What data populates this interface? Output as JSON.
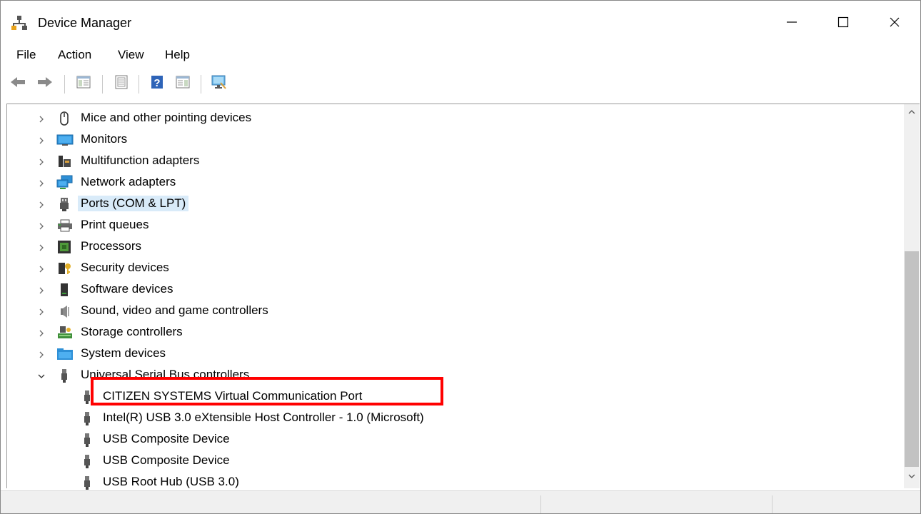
{
  "window": {
    "title": "Device Manager",
    "controls": [
      "minimize-icon",
      "maximize-icon",
      "close-icon"
    ]
  },
  "menu": [
    {
      "label": "File"
    },
    {
      "label": "Action"
    },
    {
      "label": "View"
    },
    {
      "label": "Help"
    }
  ],
  "toolbar": {
    "buttons": [
      "back-arrow-icon",
      "forward-arrow-icon",
      "show-hide-console-tree-icon",
      "properties-icon",
      "help-icon",
      "action-pane-icon",
      "scan-hardware-icon"
    ]
  },
  "tree": {
    "categories": [
      {
        "label": "Mice and other pointing devices",
        "icon": "mouse-icon"
      },
      {
        "label": "Monitors",
        "icon": "monitor-icon"
      },
      {
        "label": "Multifunction adapters",
        "icon": "multifunction-adapter-icon"
      },
      {
        "label": "Network adapters",
        "icon": "network-adapter-icon"
      },
      {
        "label": "Ports (COM & LPT)",
        "icon": "port-icon",
        "selected": true
      },
      {
        "label": "Print queues",
        "icon": "printer-icon"
      },
      {
        "label": "Processors",
        "icon": "processor-icon"
      },
      {
        "label": "Security devices",
        "icon": "security-key-icon"
      },
      {
        "label": "Software devices",
        "icon": "software-device-icon"
      },
      {
        "label": "Sound, video and game controllers",
        "icon": "speaker-icon"
      },
      {
        "label": "Storage controllers",
        "icon": "storage-controller-icon"
      },
      {
        "label": "System devices",
        "icon": "system-folder-icon"
      },
      {
        "label": "Universal Serial Bus controllers",
        "icon": "usb-icon",
        "expanded": true
      }
    ],
    "usb_children": [
      {
        "label": "CITIZEN SYSTEMS Virtual Communication Port",
        "icon": "usb-plug-icon",
        "highlighted": true
      },
      {
        "label": "Intel(R) USB 3.0 eXtensible Host Controller - 1.0 (Microsoft)",
        "icon": "usb-plug-icon"
      },
      {
        "label": "USB Composite Device",
        "icon": "usb-plug-icon"
      },
      {
        "label": "USB Composite Device",
        "icon": "usb-plug-icon"
      },
      {
        "label": "USB Root Hub (USB 3.0)",
        "icon": "usb-plug-icon"
      }
    ]
  },
  "colors": {
    "selection": "#d9ebf9",
    "highlight_box": "#ff0000",
    "statusbar": "#f0f0f0"
  }
}
